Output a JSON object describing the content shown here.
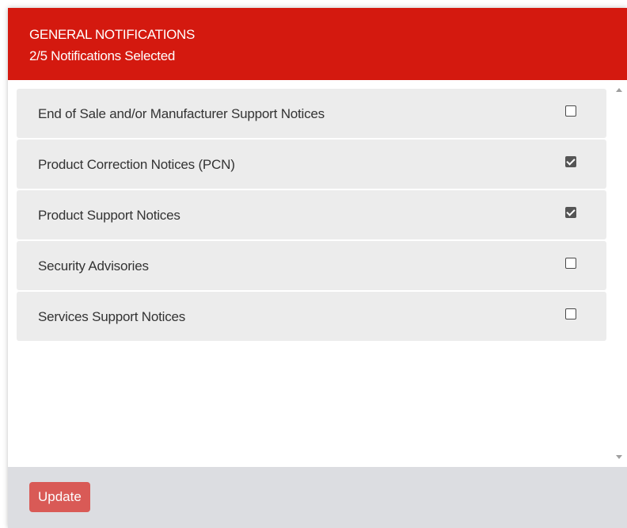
{
  "colors": {
    "header_bg": "#d4190f",
    "header_text": "#ffffff",
    "item_bg": "#ececec",
    "footer_bg": "#dcdde1",
    "button_bg": "#d9534f"
  },
  "header": {
    "title": "GENERAL NOTIFICATIONS",
    "subtitle": "2/5 Notifications Selected"
  },
  "notifications": [
    {
      "label": "End of Sale and/or Manufacturer Support Notices",
      "checked": false
    },
    {
      "label": "Product Correction Notices (PCN)",
      "checked": true
    },
    {
      "label": "Product Support Notices",
      "checked": true
    },
    {
      "label": "Security Advisories",
      "checked": false
    },
    {
      "label": "Services Support Notices",
      "checked": false
    }
  ],
  "footer": {
    "update_label": "Update"
  },
  "icons": {
    "scroll_up": "scroll-up-arrow-icon",
    "scroll_down": "scroll-down-arrow-icon"
  }
}
